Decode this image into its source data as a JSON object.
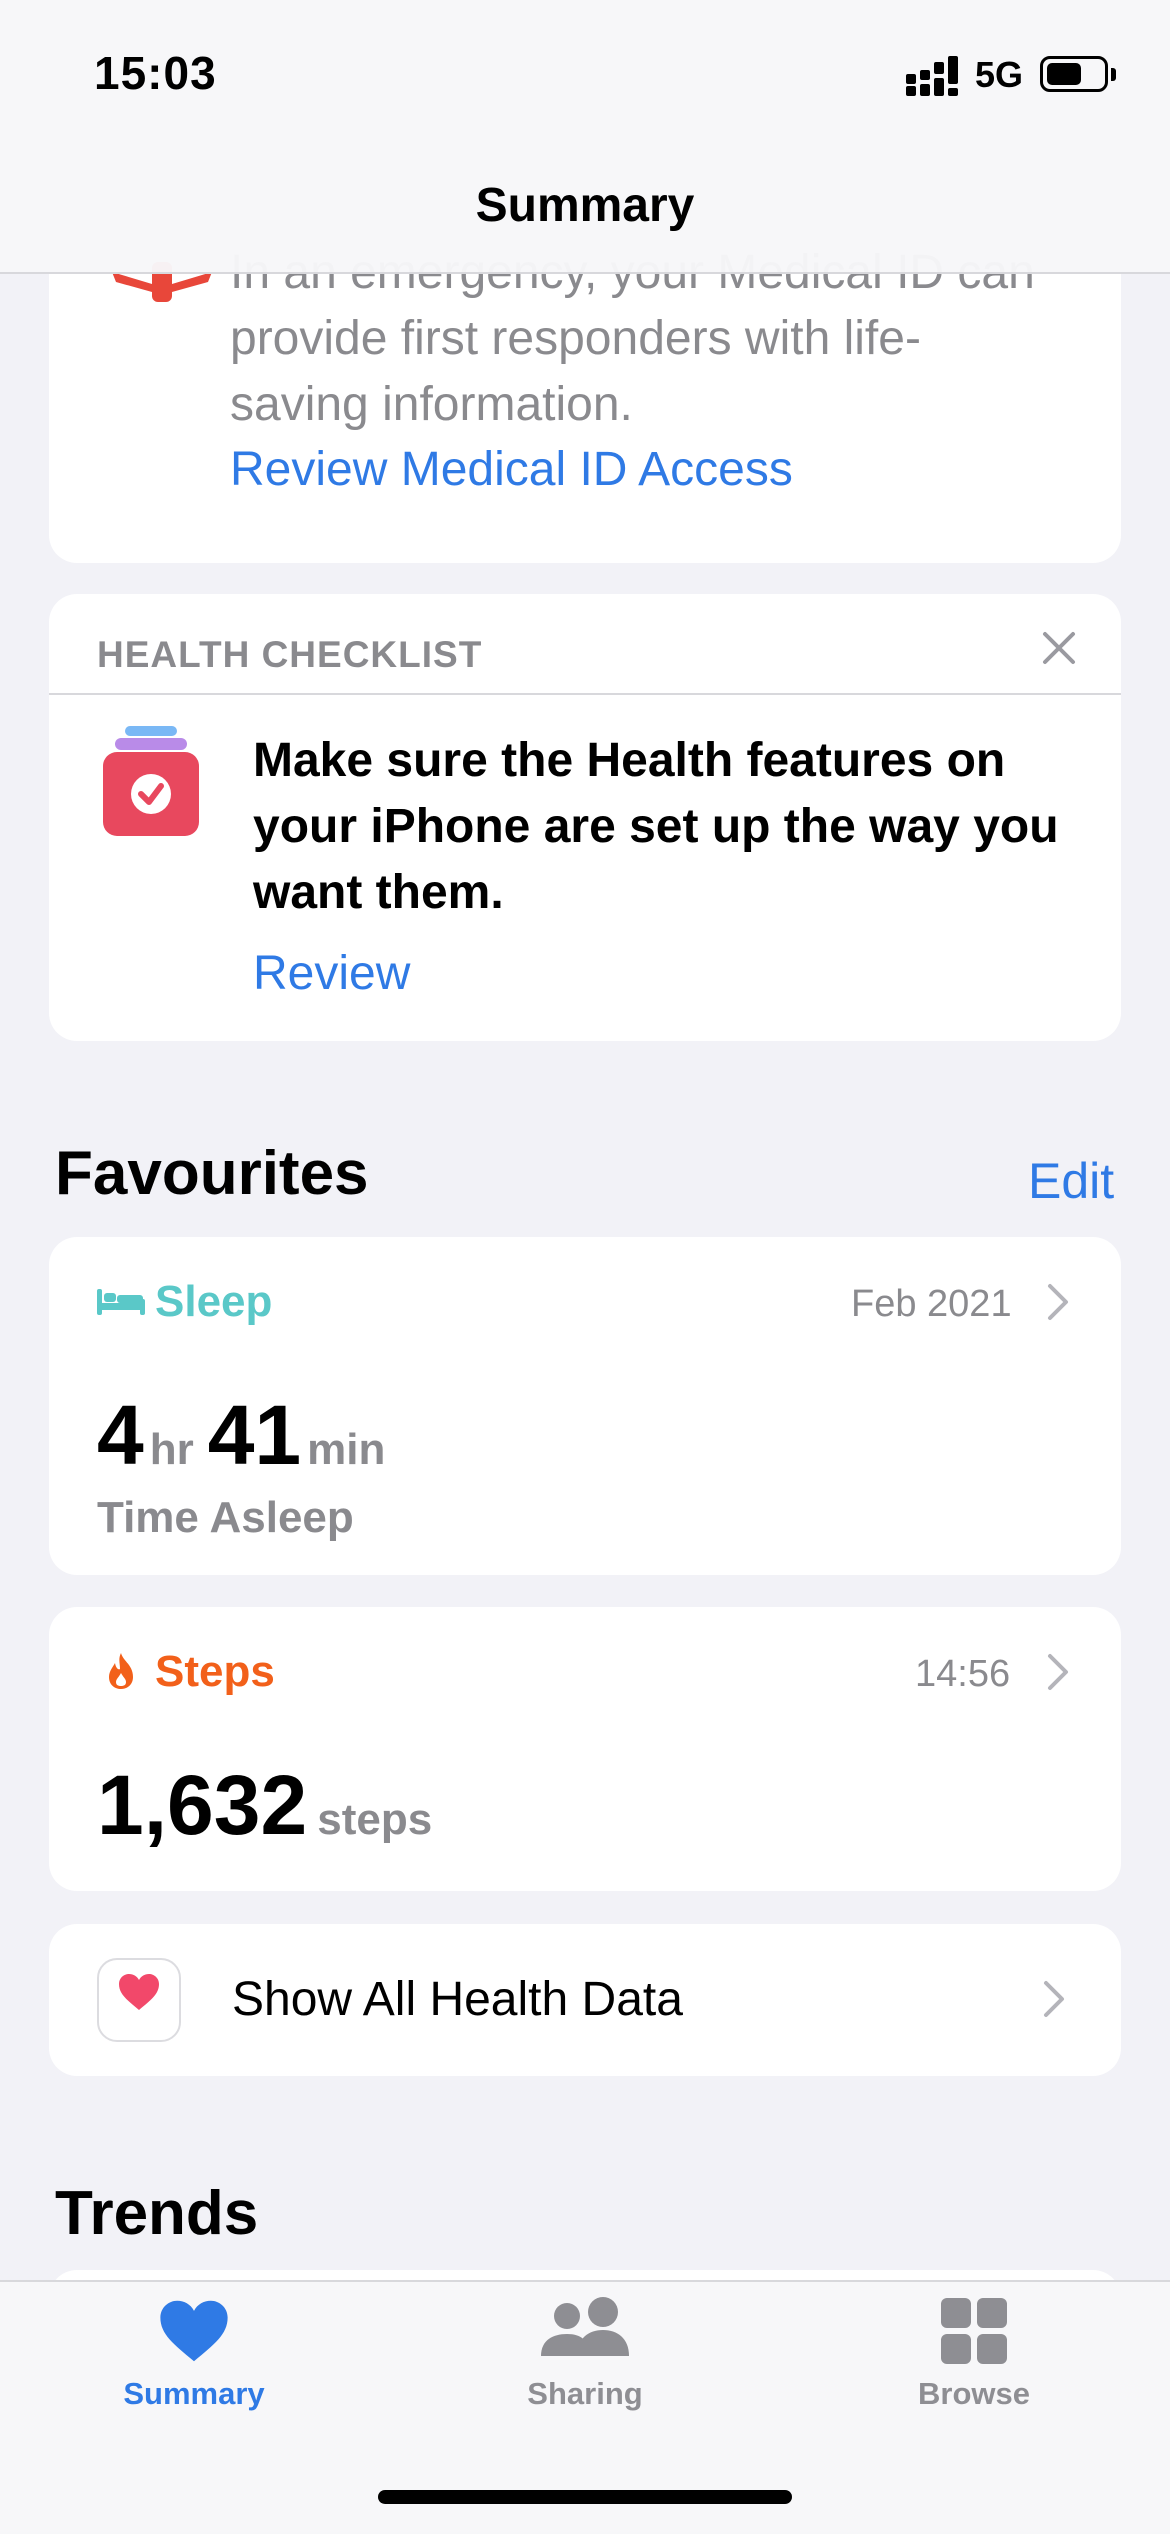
{
  "status_bar": {
    "time": "15:03",
    "network": "5G"
  },
  "nav": {
    "title": "Summary"
  },
  "medical_id": {
    "text": "In an emergency, your Medical ID can provide first responders with life-saving information.",
    "link": "Review Medical ID Access"
  },
  "checklist": {
    "header": "HEALTH CHECKLIST",
    "message": "Make sure the Health features on your iPhone are set up the way you want them.",
    "review": "Review"
  },
  "favourites": {
    "title": "Favourites",
    "edit": "Edit",
    "sleep": {
      "label": "Sleep",
      "date": "Feb 2021",
      "hours": "4",
      "hr_unit": "hr",
      "minutes": "41",
      "min_unit": "min",
      "caption": "Time Asleep"
    },
    "steps": {
      "label": "Steps",
      "time": "14:56",
      "value": "1,632",
      "unit": "steps"
    },
    "show_all": "Show All Health Data"
  },
  "trends": {
    "title": "Trends"
  },
  "tab_bar": {
    "tabs": [
      {
        "label": "Summary",
        "icon": "heart-icon",
        "active": true
      },
      {
        "label": "Sharing",
        "icon": "people-icon",
        "active": false
      },
      {
        "label": "Browse",
        "icon": "grid-icon",
        "active": false
      }
    ]
  },
  "colors": {
    "accent": "#2f7ae5",
    "sleep": "#5ac8c8",
    "steps": "#f2601a",
    "medical": "#e8473a",
    "checklist": "#e8485e"
  }
}
